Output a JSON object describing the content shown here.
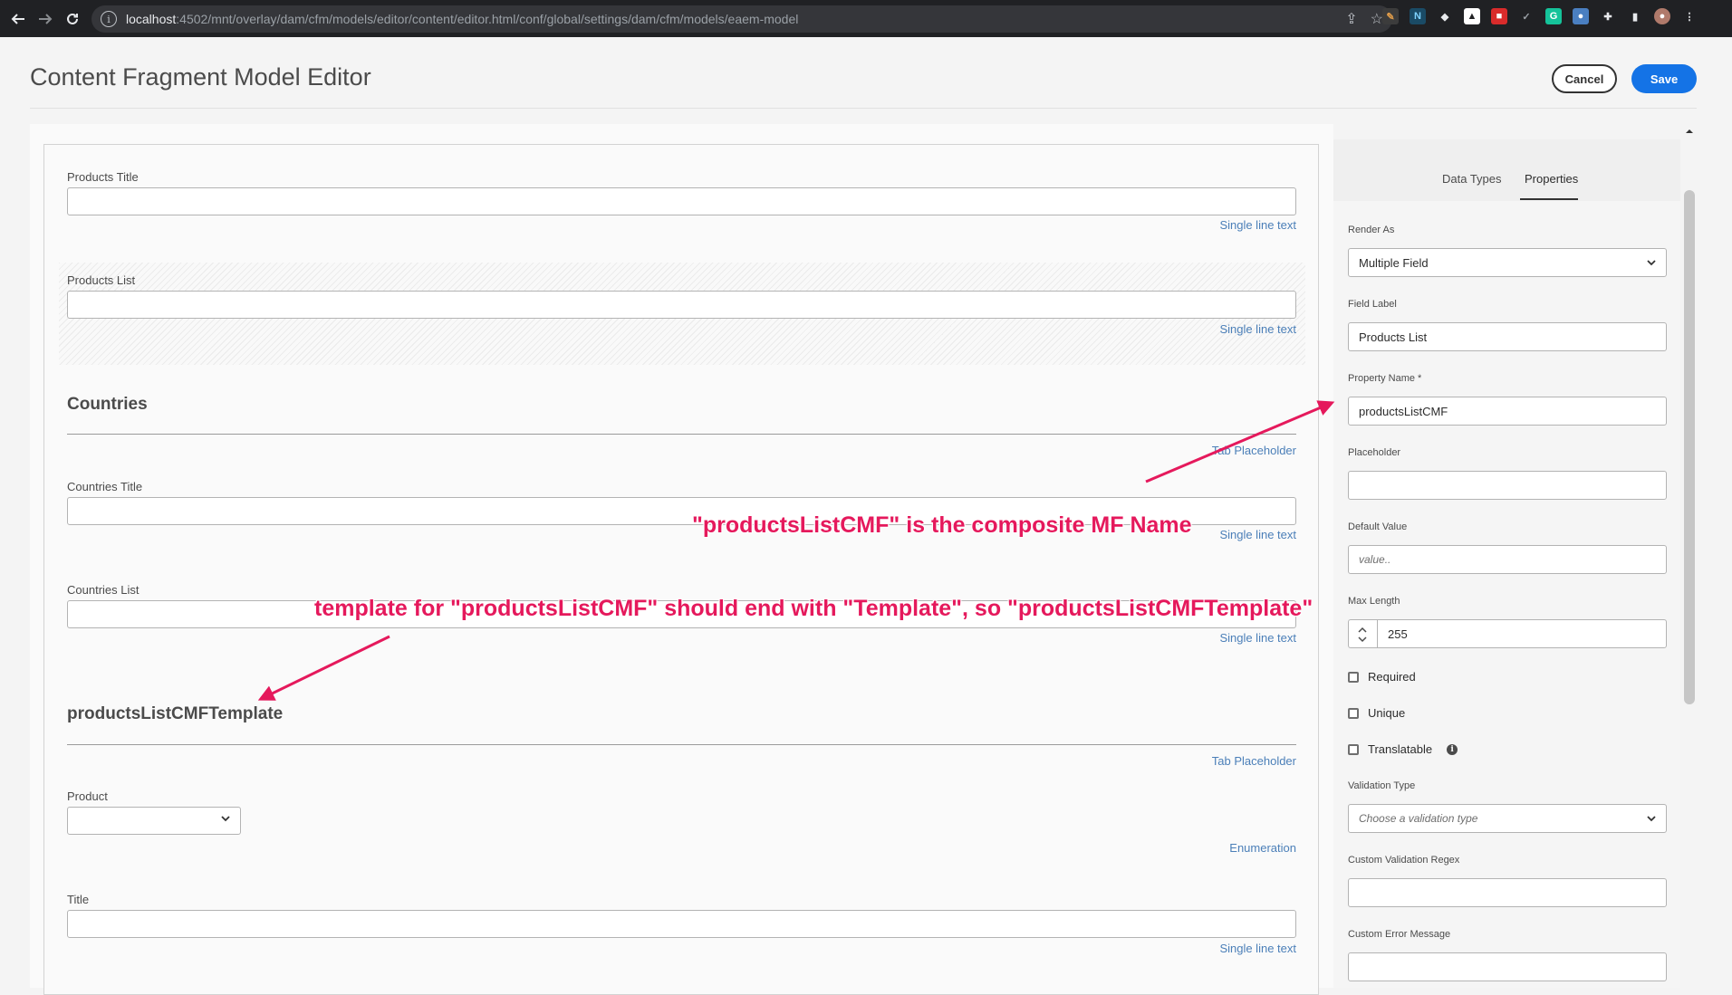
{
  "browser": {
    "url_host": "localhost",
    "url_rest": ":4502/mnt/overlay/dam/cfm/models/editor/content/editor.html/conf/global/settings/dam/cfm/models/eaem-model"
  },
  "header": {
    "title": "Content Fragment Model Editor",
    "cancel_label": "Cancel",
    "save_label": "Save"
  },
  "canvas": {
    "products_title": {
      "label": "Products Title",
      "type": "Single line text"
    },
    "products_list": {
      "label": "Products List",
      "type": "Single line text"
    },
    "countries_tab": {
      "title": "Countries",
      "type": "Tab Placeholder"
    },
    "countries_title": {
      "label": "Countries Title",
      "type": "Single line text"
    },
    "countries_list": {
      "label": "Countries List",
      "type": "Single line text"
    },
    "template_tab": {
      "title": "productsListCMFTemplate",
      "type": "Tab Placeholder"
    },
    "product": {
      "label": "Product",
      "type": "Enumeration"
    },
    "title": {
      "label": "Title",
      "type": "Single line text"
    }
  },
  "rail": {
    "tabs": [
      "Data Types",
      "Properties"
    ],
    "active_tab": "Properties",
    "render_as": {
      "label": "Render As",
      "value": "Multiple Field"
    },
    "field_label": {
      "label": "Field Label",
      "value": "Products List"
    },
    "property_name": {
      "label": "Property Name *",
      "value": "productsListCMF"
    },
    "placeholder": {
      "label": "Placeholder",
      "value": ""
    },
    "default_value": {
      "label": "Default Value",
      "placeholder": "value.."
    },
    "max_length": {
      "label": "Max Length",
      "value": "255"
    },
    "required_label": "Required",
    "unique_label": "Unique",
    "translatable_label": "Translatable",
    "validation_type": {
      "label": "Validation Type",
      "placeholder": "Choose a validation type"
    },
    "custom_regex": {
      "label": "Custom Validation Regex"
    },
    "custom_error": {
      "label": "Custom Error Message"
    }
  },
  "annotations": {
    "composite_name": "\"productsListCMF\" is the composite MF Name",
    "template_rule": "template for \"productsListCMF\" should end with \"Template\", so \"productsListCMFTemplate\""
  },
  "colors": {
    "accent": "#1473e6",
    "annotation": "#e5195c",
    "hint_link": "#4b7fb8"
  }
}
